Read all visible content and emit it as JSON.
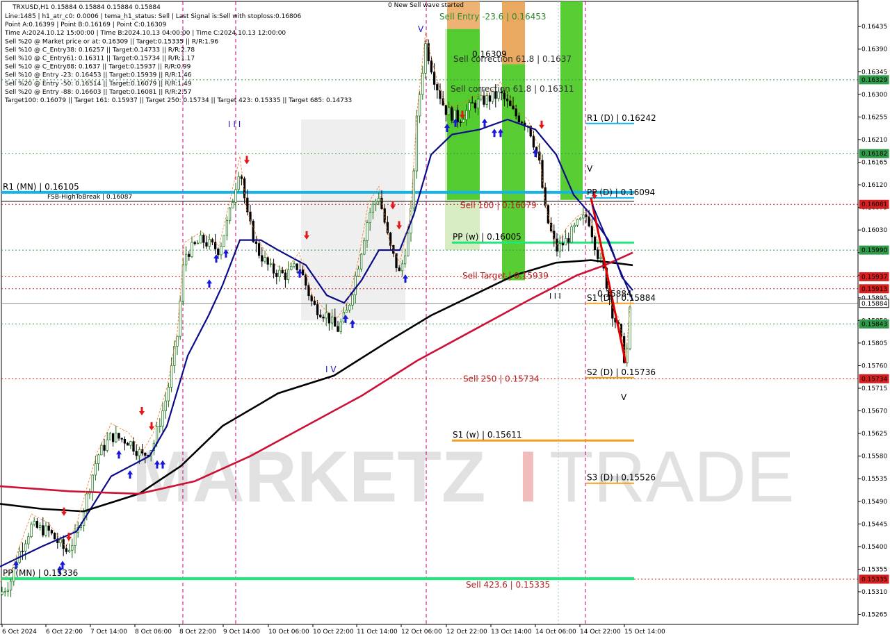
{
  "header": {
    "symbol": "TRXUSD,H1  0.15884 0.15884 0.15884 0.15884",
    "lines": [
      "Line:1485  |  h1_atr_c0: 0.0006  |  tema_h1_status: Sell  |  Last Signal is:Sell with stoploss:0.16806",
      "Point A:0.16399  |  Point B:0.16169  |  Point C:0.16309",
      "Time A:2024.10.12 15:00:00  |  Time B:2024.10.13 04:00:00  |  Time C:2024.10.13 12:00:00",
      "Sell %20 @ Market price or at: 0.16309  ||  Target:0.15335  ||  R/R:1.96",
      "Sell %10 @ C_Entry38: 0.16257  ||  Target:0.14733  ||  R/R:2.78",
      "Sell %10 @ C_Entry61: 0.16311  ||  Target:0.15734  ||  R/R:1.17",
      "Sell %10 @ C_Entry88: 0.1637  ||  Target:0.15937  ||  R/R:0.99",
      "Sell %10 @ Entry -23: 0.16453  ||  Target:0.15939  ||  R/R:1.46",
      "Sell %20 @ Entry -50: 0.16514  ||  Target:0.16079  ||  R/R:1.49",
      "Sell %20 @ Entry -88: 0.16603  ||  Target:0.16081  ||  R/R:2.57",
      "Target100: 0.16079  ||  Target 161: 0.15937  ||  Target 250: 0.15734  ||  Target 423: 0.15335  ||  Target 685: 0.14733"
    ]
  },
  "watermark": {
    "left": "MARKETZ",
    "mid": "I",
    "right": "TRADE"
  },
  "chart_data": {
    "type": "candlestick",
    "symbol": "TRXUSD",
    "timeframe": "H1",
    "ylim": [
      0.15245,
      0.16485
    ],
    "y_ticks": [
      "0.16435",
      "0.16390",
      "0.16345",
      "0.16300",
      "0.16255",
      "0.16210",
      "0.16165",
      "0.16120",
      "0.16075",
      "0.16030",
      "0.15985",
      "0.15940",
      "0.15895",
      "0.15850",
      "0.15805",
      "0.15760",
      "0.15715",
      "0.15670",
      "0.15625",
      "0.15580",
      "0.15535",
      "0.15490",
      "0.15445",
      "0.15400",
      "0.15355",
      "0.15310",
      "0.15265"
    ],
    "x_ticks": [
      "6 Oct 2024",
      "6 Oct 22:00",
      "7 Oct 14:00",
      "8 Oct 06:00",
      "8 Oct 22:00",
      "9 Oct 14:00",
      "10 Oct 06:00",
      "10 Oct 22:00",
      "11 Oct 14:00",
      "12 Oct 06:00",
      "12 Oct 22:00",
      "13 Oct 14:00",
      "14 Oct 06:00",
      "14 Oct 22:00",
      "15 Oct 14:00"
    ],
    "price_path": [
      [
        0,
        0.15305
      ],
      [
        15,
        0.1533
      ],
      [
        25,
        0.1538
      ],
      [
        45,
        0.1544
      ],
      [
        70,
        0.1543
      ],
      [
        95,
        0.1539
      ],
      [
        110,
        0.1542
      ],
      [
        125,
        0.155
      ],
      [
        140,
        0.1558
      ],
      [
        160,
        0.1562
      ],
      [
        185,
        0.1561
      ],
      [
        205,
        0.1558
      ],
      [
        220,
        0.156
      ],
      [
        240,
        0.157
      ],
      [
        255,
        0.1582
      ],
      [
        265,
        0.1598
      ],
      [
        290,
        0.1601
      ],
      [
        315,
        0.1599
      ],
      [
        330,
        0.1606
      ],
      [
        345,
        0.1616
      ],
      [
        355,
        0.1606
      ],
      [
        370,
        0.1599
      ],
      [
        390,
        0.1595
      ],
      [
        410,
        0.1594
      ],
      [
        430,
        0.1596
      ],
      [
        450,
        0.1588
      ],
      [
        470,
        0.1586
      ],
      [
        485,
        0.1583
      ],
      [
        500,
        0.1587
      ],
      [
        515,
        0.1596
      ],
      [
        530,
        0.1606
      ],
      [
        545,
        0.161
      ],
      [
        560,
        0.16
      ],
      [
        575,
        0.1594
      ],
      [
        590,
        0.1604
      ],
      [
        600,
        0.1626
      ],
      [
        612,
        0.16399
      ],
      [
        625,
        0.1633
      ],
      [
        640,
        0.1627
      ],
      [
        660,
        0.1625
      ],
      [
        680,
        0.1628
      ],
      [
        700,
        0.1629
      ],
      [
        720,
        0.163
      ],
      [
        740,
        0.1626
      ],
      [
        760,
        0.1624
      ],
      [
        775,
        0.16169
      ],
      [
        785,
        0.1606
      ],
      [
        800,
        0.1599
      ],
      [
        815,
        0.1601
      ],
      [
        830,
        0.1604
      ],
      [
        845,
        0.1606
      ],
      [
        858,
        0.1599
      ],
      [
        870,
        0.1594
      ],
      [
        880,
        0.1587
      ],
      [
        890,
        0.1583
      ],
      [
        900,
        0.1576
      ],
      [
        907,
        0.15884
      ]
    ],
    "series": [
      {
        "name": "",
        "color": "#0b0b8a",
        "points": [
          [
            0,
            0.1536
          ],
          [
            60,
            0.154
          ],
          [
            110,
            0.1543
          ],
          [
            160,
            0.1554
          ],
          [
            215,
            0.1558
          ],
          [
            240,
            0.1564
          ],
          [
            270,
            0.1578
          ],
          [
            300,
            0.1586
          ],
          [
            320,
            0.1592
          ],
          [
            345,
            0.1601
          ],
          [
            375,
            0.1601
          ],
          [
            400,
            0.1599
          ],
          [
            440,
            0.1596
          ],
          [
            470,
            0.159
          ],
          [
            495,
            0.15885
          ],
          [
            520,
            0.1593
          ],
          [
            545,
            0.1599
          ],
          [
            575,
            0.1599
          ],
          [
            595,
            0.1606
          ],
          [
            620,
            0.1618
          ],
          [
            650,
            0.1622
          ],
          [
            690,
            0.1623
          ],
          [
            730,
            0.1625
          ],
          [
            770,
            0.1623
          ],
          [
            800,
            0.1618
          ],
          [
            825,
            0.161
          ],
          [
            850,
            0.1606
          ],
          [
            875,
            0.1601
          ],
          [
            895,
            0.15935
          ],
          [
            910,
            0.1591
          ]
        ]
      },
      {
        "name": "",
        "color": "#000000",
        "points": [
          [
            0,
            0.15485
          ],
          [
            60,
            0.15475
          ],
          [
            120,
            0.1547
          ],
          [
            200,
            0.15505
          ],
          [
            260,
            0.1556
          ],
          [
            320,
            0.1564
          ],
          [
            400,
            0.15705
          ],
          [
            480,
            0.1574
          ],
          [
            560,
            0.1581
          ],
          [
            620,
            0.1586
          ],
          [
            680,
            0.159
          ],
          [
            740,
            0.1594
          ],
          [
            800,
            0.15965
          ],
          [
            850,
            0.1597
          ],
          [
            910,
            0.1596
          ]
        ]
      },
      {
        "name": "",
        "color": "#cc1036",
        "points": [
          [
            0,
            0.1552
          ],
          [
            100,
            0.1551
          ],
          [
            200,
            0.15505
          ],
          [
            280,
            0.1553
          ],
          [
            360,
            0.1558
          ],
          [
            440,
            0.1564
          ],
          [
            520,
            0.157
          ],
          [
            600,
            0.1577
          ],
          [
            680,
            0.1583
          ],
          [
            760,
            0.1589
          ],
          [
            830,
            0.1594
          ],
          [
            870,
            0.1596
          ],
          [
            910,
            0.15985
          ]
        ]
      }
    ],
    "levels": [
      {
        "label": "R1 (MN) | 0.16105",
        "value": 0.16105,
        "color": "#12b4ec",
        "style": "thick"
      },
      {
        "label": "FSB-HighToBreak | 0.16087",
        "value": 0.16087,
        "color": "#000000",
        "style": "thin"
      },
      {
        "label": "R1 (D) | 0.16242",
        "value": 0.16242,
        "color": "#12b4ec",
        "style": "short"
      },
      {
        "label": "PP (D) | 0.16094",
        "value": 0.16094,
        "color": "#12b4ec",
        "style": "short"
      },
      {
        "label": "PP (w) | 0.16005",
        "value": 0.16005,
        "color": "#1de87a",
        "style": "short-thick"
      },
      {
        "label": "S1 (D) | 0.15884",
        "value": 0.15884,
        "color": "#f0a020",
        "style": "short"
      },
      {
        "label": "S2 (D) | 0.15736",
        "value": 0.15736,
        "color": "#f0a020",
        "style": "short"
      },
      {
        "label": "S1 (w) | 0.15611",
        "value": 0.15611,
        "color": "#f0a020",
        "style": "short-thick"
      },
      {
        "label": "S3 (D) | 0.15526",
        "value": 0.15526,
        "color": "#f0a020",
        "style": "short"
      },
      {
        "label": "PP (MN) | 0.15336",
        "value": 0.15336,
        "color": "#1de87a",
        "style": "thick"
      }
    ],
    "target_labels": [
      {
        "label": "Sell Entry -23.6 | 0.16453",
        "value": 0.16453,
        "color": "#2d8a2d"
      },
      {
        "label": "Sell correction 61.8 | 0.1637",
        "value": 0.1637,
        "color": "#2d2d2d"
      },
      {
        "label": "Sell correction 61.8 | 0.16311",
        "value": 0.16311,
        "color": "#2d2d2d"
      },
      {
        "label": "Sell 100 | 0.16079",
        "value": 0.16079,
        "color": "#b22222"
      },
      {
        "label": "Sell Target | 0.15939",
        "value": 0.15939,
        "color": "#b22222"
      },
      {
        "label": "Sell 250 | 0.15734",
        "value": 0.15734,
        "color": "#b22222"
      },
      {
        "label": "Sell 423.6 | 0.15335",
        "value": 0.15335,
        "color": "#b22222"
      }
    ],
    "price_tags": [
      {
        "value": "0.16329",
        "bg": "#2f9a4a"
      },
      {
        "value": "0.16182",
        "bg": "#2f9a4a"
      },
      {
        "value": "0.16081",
        "bg": "#d62020"
      },
      {
        "value": "0.15990",
        "bg": "#2f9a4a"
      },
      {
        "value": "0.15937",
        "bg": "#d62020"
      },
      {
        "value": "0.15913",
        "bg": "#d62020"
      },
      {
        "value": "0.15884",
        "bg": "#ffffff"
      },
      {
        "value": "0.15843",
        "bg": "#2f9a4a"
      },
      {
        "value": "0.15734",
        "bg": "#d62020"
      },
      {
        "value": "0.15335",
        "bg": "#d62020"
      }
    ],
    "annotations": [
      "0 New Sell wave started",
      "I I I",
      "I V",
      "V",
      "V",
      "V",
      "I I I",
      "0.16309",
      "0.15884"
    ]
  }
}
